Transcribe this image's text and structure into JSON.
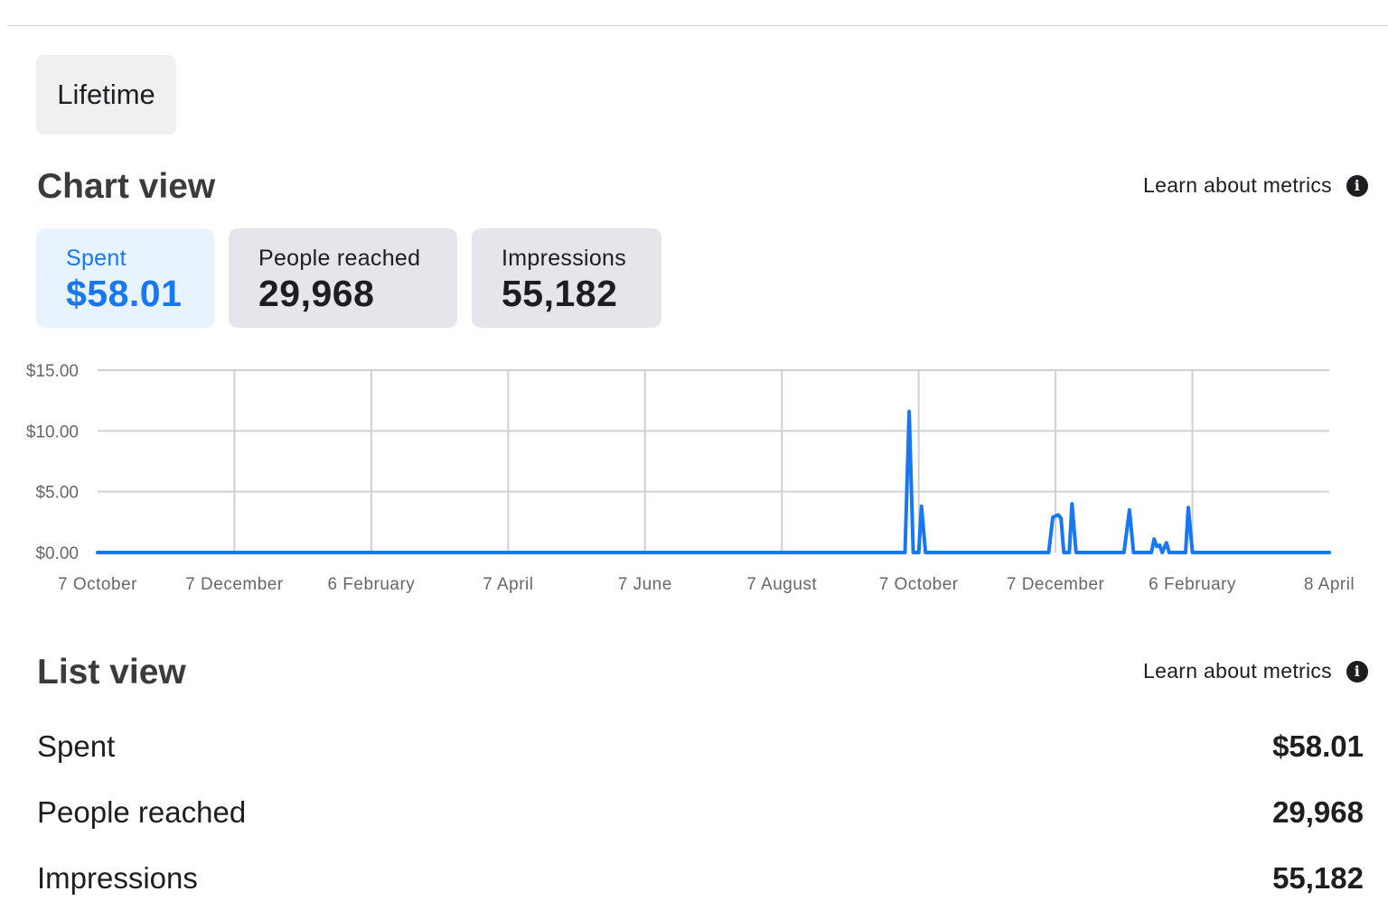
{
  "period": {
    "label": "Lifetime"
  },
  "chart_section": {
    "title": "Chart view",
    "learn_link": "Learn about metrics"
  },
  "metrics": [
    {
      "label": "Spent",
      "value": "$58.01"
    },
    {
      "label": "People reached",
      "value": "29,968"
    },
    {
      "label": "Impressions",
      "value": "55,182"
    }
  ],
  "list_section": {
    "title": "List view",
    "learn_link": "Learn about metrics",
    "rows": [
      {
        "label": "Spent",
        "value": "$58.01"
      },
      {
        "label": "People reached",
        "value": "29,968"
      },
      {
        "label": "Impressions",
        "value": "55,182"
      }
    ]
  },
  "colors": {
    "accent": "#1877f2",
    "grid": "#cfd0d4",
    "active_card_bg": "#e7f3ff",
    "card_bg": "#e4e6eb"
  },
  "chart_data": {
    "type": "line",
    "title": "",
    "xlabel": "",
    "ylabel": "",
    "grid": true,
    "ylim": [
      0,
      15
    ],
    "y_ticks": [
      "$0.00",
      "$5.00",
      "$10.00",
      "$15.00"
    ],
    "x_ticks": [
      "7 October",
      "7 December",
      "6 February",
      "7 April",
      "7 June",
      "7 August",
      "7 October",
      "7 December",
      "6 February",
      "8 April"
    ],
    "x_range": [
      0,
      9
    ],
    "series": [
      {
        "color": "#1877f2",
        "points": [
          [
            0,
            0
          ],
          [
            5.9,
            0
          ],
          [
            5.93,
            11.6
          ],
          [
            5.96,
            0
          ],
          [
            6.0,
            0
          ],
          [
            6.02,
            3.8
          ],
          [
            6.05,
            0
          ],
          [
            6.95,
            0
          ],
          [
            6.98,
            2.9
          ],
          [
            7.0,
            3.0
          ],
          [
            7.02,
            3.1
          ],
          [
            7.04,
            2.8
          ],
          [
            7.06,
            0
          ],
          [
            7.1,
            0
          ],
          [
            7.12,
            4.0
          ],
          [
            7.15,
            0
          ],
          [
            7.5,
            0
          ],
          [
            7.54,
            3.5
          ],
          [
            7.57,
            0
          ],
          [
            7.7,
            0
          ],
          [
            7.72,
            1.1
          ],
          [
            7.74,
            0.5
          ],
          [
            7.76,
            0.6
          ],
          [
            7.78,
            0
          ],
          [
            7.81,
            0.8
          ],
          [
            7.83,
            0
          ],
          [
            7.95,
            0
          ],
          [
            7.97,
            3.7
          ],
          [
            8.0,
            0
          ],
          [
            9,
            0
          ]
        ]
      }
    ]
  }
}
